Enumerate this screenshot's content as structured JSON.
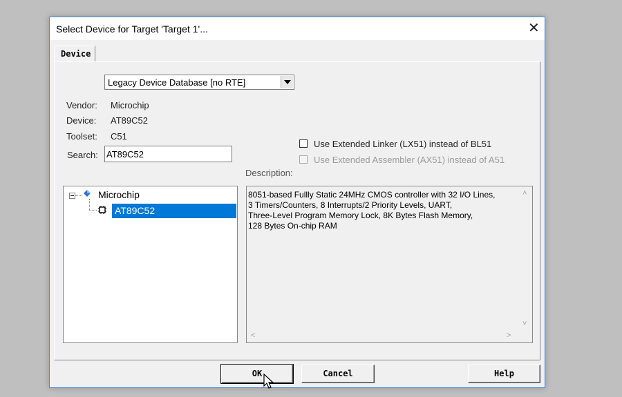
{
  "window": {
    "title": "Select Device for Target 'Target 1'...",
    "close_glyph": "✕"
  },
  "tabs": [
    {
      "label": "Device",
      "active": true
    }
  ],
  "database_select": {
    "selected": "Legacy Device Database [no RTE]"
  },
  "info": {
    "vendor_label": "Vendor:",
    "vendor_value": "Microchip",
    "device_label": "Device:",
    "device_value": "AT89C52",
    "toolset_label": "Toolset:",
    "toolset_value": "C51",
    "search_label": "Search:",
    "search_value": "AT89C52"
  },
  "options": {
    "extended_linker": {
      "label": "Use Extended Linker (LX51) instead of BL51",
      "checked": false,
      "enabled": true
    },
    "extended_assembler": {
      "label": "Use Extended Assembler (AX51) instead of A51",
      "checked": false,
      "enabled": false
    }
  },
  "tree": {
    "vendor": "Microchip",
    "device": "AT89C52",
    "selected": "AT89C52"
  },
  "description": {
    "label": "Description:",
    "lines": [
      "8051-based Fullly Static 24MHz CMOS controller with 32  I/O Lines,",
      "3 Timers/Counters, 8 Interrupts/2 Priority Levels, UART,",
      "Three-Level Program Memory Lock, 8K Bytes Flash Memory,",
      "128 Bytes On-chip RAM"
    ]
  },
  "buttons": {
    "ok": "OK",
    "cancel": "Cancel",
    "help": "Help"
  },
  "icons": {
    "close": "close-icon",
    "dropdown": "chevron-down-icon",
    "vendor": "vendor-diamond-icon",
    "device": "chip-icon",
    "cursor": "mouse-pointer-icon"
  },
  "colors": {
    "selection": "#0078d7",
    "window_border": "#4a8ad8",
    "dialog_bg": "#f0f0f0"
  }
}
